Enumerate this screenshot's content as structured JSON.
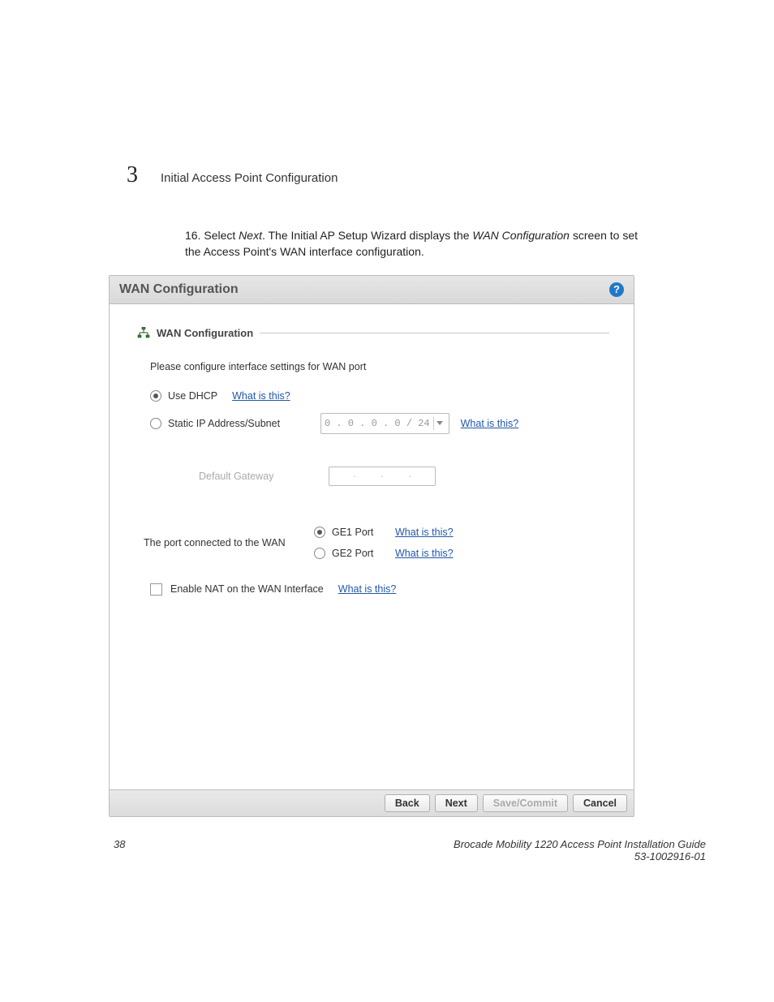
{
  "header": {
    "chapter_number": "3",
    "chapter_title": "Initial Access Point Configuration"
  },
  "step": {
    "number": "16.",
    "prefix": "Select ",
    "action": "Next",
    "mid1": ". The Initial AP Setup Wizard displays the ",
    "screen": "WAN Configuration",
    "suffix": " screen to set the Access Point's WAN interface configuration."
  },
  "panel": {
    "title": "WAN Configuration",
    "section_label": "WAN Configuration",
    "intro": "Please configure interface settings for WAN port",
    "dhcp": {
      "label": "Use DHCP",
      "help": "What is this?"
    },
    "static": {
      "label": "Static IP Address/Subnet",
      "ip": "0 . 0 . 0 . 0 / 24",
      "help": "What is this?"
    },
    "gateway": {
      "label": "Default Gateway",
      "dots": ". . ."
    },
    "port_label": "The port connected to the WAN",
    "ge1": {
      "label": "GE1 Port",
      "help": "What is this?"
    },
    "ge2": {
      "label": "GE2 Port",
      "help": "What is this?"
    },
    "nat": {
      "label": "Enable NAT on the WAN Interface",
      "help": "What is this?"
    },
    "buttons": {
      "back": "Back",
      "next": "Next",
      "save": "Save/Commit",
      "cancel": "Cancel"
    },
    "help_icon": "?"
  },
  "footer": {
    "page_number": "38",
    "guide_title": "Brocade Mobility 1220 Access Point Installation Guide",
    "doc_number": "53-1002916-01"
  }
}
